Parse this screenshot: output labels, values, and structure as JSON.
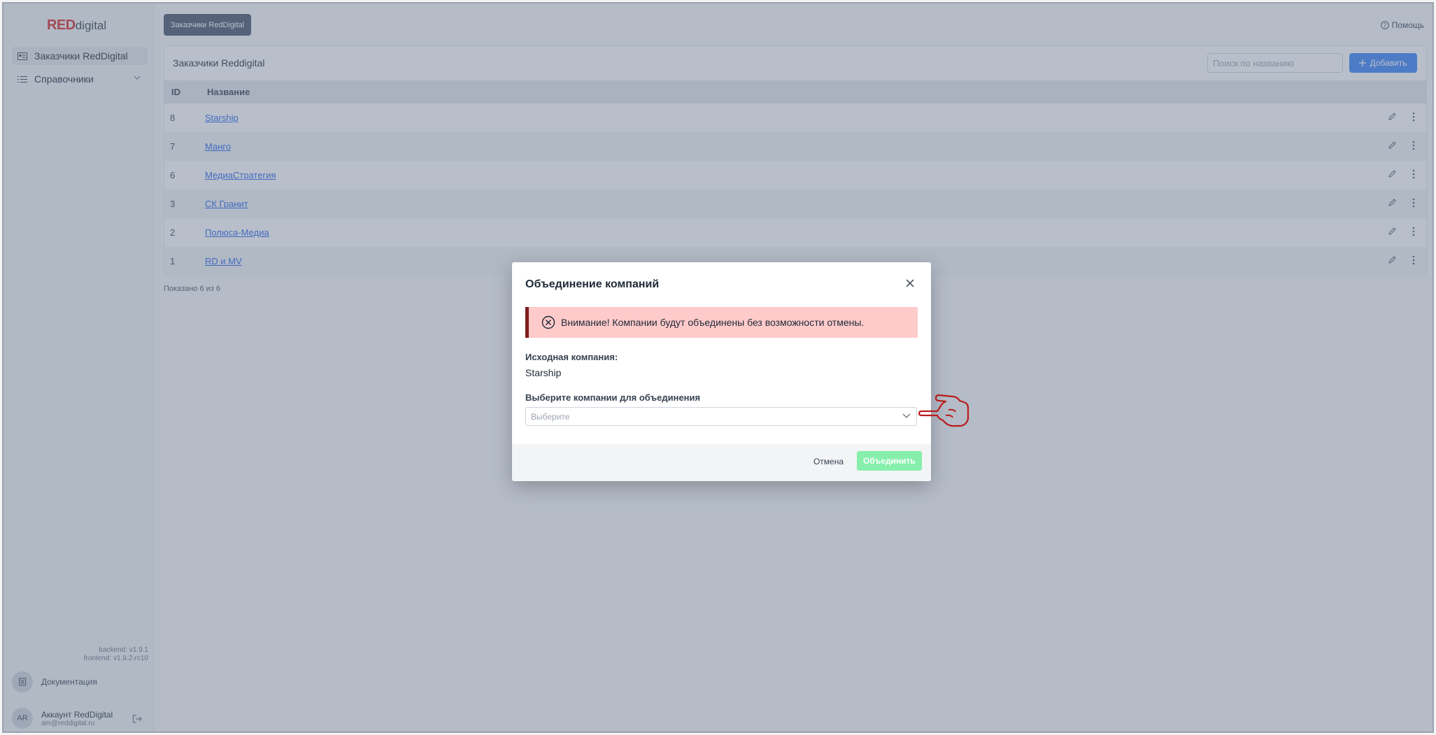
{
  "logo": {
    "brand": "RED",
    "suffix": "digital"
  },
  "sidebar": {
    "items": [
      {
        "label": "Заказчики RedDigital",
        "icon": "id-card-icon"
      },
      {
        "label": "Справочники",
        "icon": "list-icon"
      }
    ],
    "versions": {
      "backend": "backend: v1.9.1",
      "frontend": "frontend: v1.9.2-rc10"
    },
    "docs_label": "Документация",
    "account": {
      "initials": "AR",
      "name": "Аккаунт RedDigital",
      "email": "am@reddigital.ru"
    }
  },
  "header": {
    "breadcrumb": "Заказчики RedDigital",
    "help": "Помощь"
  },
  "card": {
    "title": "Заказчики Reddigital",
    "search_placeholder": "Поиск по названию",
    "add_label": "Добавить",
    "columns": [
      "ID",
      "Название"
    ],
    "rows": [
      {
        "id": "8",
        "name": "Starship"
      },
      {
        "id": "7",
        "name": "Манго"
      },
      {
        "id": "6",
        "name": "МедиаСтратегия"
      },
      {
        "id": "3",
        "name": "СК Гранит"
      },
      {
        "id": "2",
        "name": "Полюса-Медиа"
      },
      {
        "id": "1",
        "name": "RD и MV"
      }
    ],
    "footer": "Показано 6 из 6"
  },
  "modal": {
    "title": "Объединение компаний",
    "alert": "Внимание! Компании будут объединены без возможности отмены.",
    "source_label": "Исходная компания:",
    "source_value": "Starship",
    "select_label": "Выберите компании для объединения",
    "select_placeholder": "Выберите",
    "cancel": "Отмена",
    "merge": "Объединить"
  },
  "colors": {
    "brand": "#dc2626",
    "primary": "#3b82f6",
    "alert_bg": "#fecaca",
    "merge_btn": "#86efac"
  }
}
